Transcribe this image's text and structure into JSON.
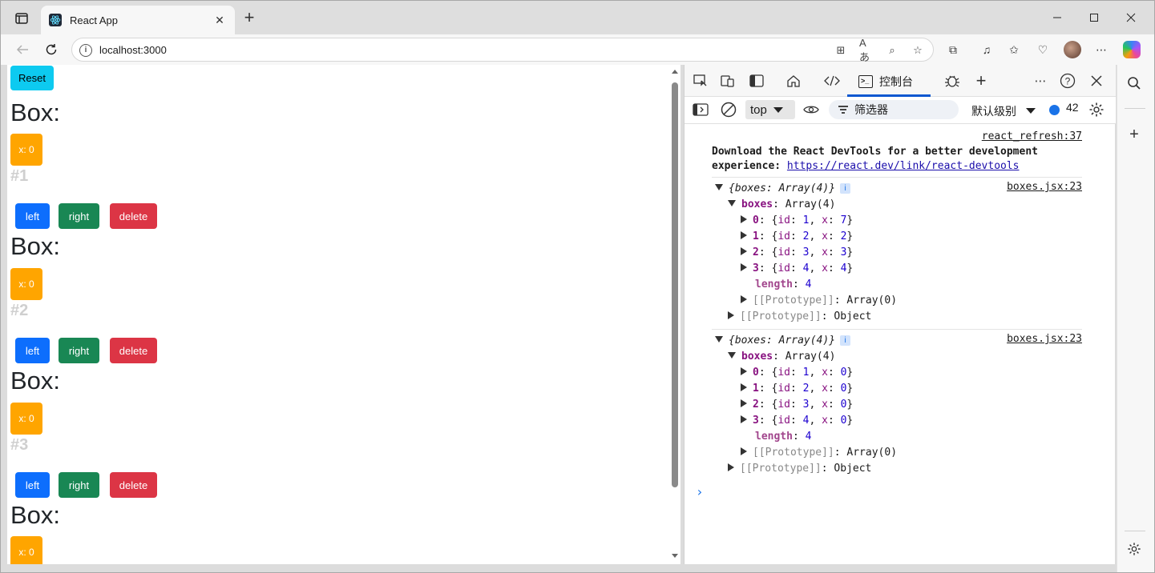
{
  "browser": {
    "tab_title": "React App",
    "address": "localhost:3000"
  },
  "page": {
    "reset_label": "Reset",
    "boxes": [
      {
        "heading": "Box:",
        "value_label": "x: 0",
        "id_label": "#1",
        "left_label": "left",
        "right_label": "right",
        "delete_label": "delete"
      },
      {
        "heading": "Box:",
        "value_label": "x: 0",
        "id_label": "#2",
        "left_label": "left",
        "right_label": "right",
        "delete_label": "delete"
      },
      {
        "heading": "Box:",
        "value_label": "x: 0",
        "id_label": "#3",
        "left_label": "left",
        "right_label": "right",
        "delete_label": "delete"
      },
      {
        "heading": "Box:",
        "value_label": "x: 0"
      }
    ]
  },
  "devtools": {
    "active_tab": "控制台",
    "context": "top",
    "filter_placeholder": "筛选器",
    "level": "默认级别",
    "message_count": "42",
    "console": {
      "source_refresh": "react_refresh:37",
      "devtools_msg_line1": "Download the React DevTools for a better development",
      "devtools_msg_line2_prefix": "experience: ",
      "devtools_link": "https://react.dev/link/react-devtools",
      "logs": [
        {
          "source": "boxes.jsx:23",
          "summary": "{boxes: Array(4)}",
          "items": [
            {
              "index": "0",
              "id": "1",
              "x": "7"
            },
            {
              "index": "1",
              "id": "2",
              "x": "2"
            },
            {
              "index": "2",
              "id": "3",
              "x": "3"
            },
            {
              "index": "3",
              "id": "4",
              "x": "4"
            }
          ]
        },
        {
          "source": "boxes.jsx:23",
          "summary": "{boxes: Array(4)}",
          "items": [
            {
              "index": "0",
              "id": "1",
              "x": "0"
            },
            {
              "index": "1",
              "id": "2",
              "x": "0"
            },
            {
              "index": "2",
              "id": "3",
              "x": "0"
            },
            {
              "index": "3",
              "id": "4",
              "x": "0"
            }
          ]
        }
      ],
      "boxes_key": "boxes",
      "array_label": "Array(4)",
      "length_key": "length",
      "length_value": "4",
      "proto_key": "[[Prototype]]",
      "proto_array": "Array(0)",
      "proto_object": "Object",
      "prompt": "›"
    }
  }
}
